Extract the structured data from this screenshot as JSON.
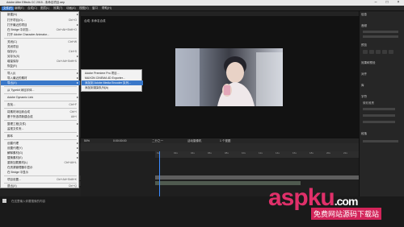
{
  "window": {
    "title": "Adobe After Effects CC 2015 - 未命名项目.aep",
    "controls": [
      "–",
      "□",
      "×"
    ]
  },
  "menubar": {
    "items": [
      "文件(F)",
      "编辑(E)",
      "合成(C)",
      "图层(L)",
      "效果(T)",
      "动画(A)",
      "视图(V)",
      "窗口",
      "帮助(H)"
    ],
    "active_index": 0
  },
  "file_menu": {
    "items": [
      {
        "label": "新建(N)",
        "shortcut": "",
        "arrow": true
      },
      {
        "label": "打开项目(O)...",
        "shortcut": "Ctrl+O"
      },
      {
        "label": "打开最近的项目",
        "shortcut": "",
        "arrow": true
      },
      {
        "label": "在 Bridge 中浏览...",
        "shortcut": "Ctrl+Alt+Shift+O"
      },
      {
        "label": "打开 Adobe Character Animator...",
        "shortcut": ""
      },
      {
        "label": "关闭(C)",
        "shortcut": "Ctrl+W"
      },
      {
        "label": "关闭项目",
        "shortcut": ""
      },
      {
        "label": "保存(S)",
        "shortcut": "Ctrl+S"
      },
      {
        "label": "另存为(S)",
        "shortcut": "",
        "arrow": true
      },
      {
        "label": "增量保存",
        "shortcut": "Ctrl+Alt+Shift+S"
      },
      {
        "label": "恢复(R)",
        "shortcut": ""
      },
      {
        "label": "导入(I)",
        "shortcut": "",
        "arrow": true
      },
      {
        "label": "导入最近的素材",
        "shortcut": "",
        "arrow": true
      },
      {
        "label": "导出(X)",
        "shortcut": "",
        "arrow": true
      },
      {
        "label": "从 Typekit 添加字体...",
        "shortcut": ""
      },
      {
        "label": "Adobe Dynamic Link",
        "shortcut": "",
        "arrow": true
      },
      {
        "label": "查找...",
        "shortcut": "Ctrl+F"
      },
      {
        "label": "将素材添加到合成",
        "shortcut": "Ctrl+/"
      },
      {
        "label": "基于所选项新建合成",
        "shortcut": "Alt+\\"
      },
      {
        "label": "整理工程(文件)",
        "shortcut": "",
        "arrow": true
      },
      {
        "label": "监视文件夹...",
        "shortcut": ""
      },
      {
        "label": "脚本",
        "shortcut": "",
        "arrow": true
      },
      {
        "label": "创建代理",
        "shortcut": "",
        "arrow": true
      },
      {
        "label": "设置代理(Y)",
        "shortcut": "",
        "arrow": true
      },
      {
        "label": "解释素材(G)",
        "shortcut": "",
        "arrow": true
      },
      {
        "label": "替换素材(E)",
        "shortcut": "",
        "arrow": true
      },
      {
        "label": "重新加载素材(L)",
        "shortcut": "Ctrl+Alt+L"
      },
      {
        "label": "在资源管理器中显示",
        "shortcut": ""
      },
      {
        "label": "在 Bridge 中显示",
        "shortcut": ""
      },
      {
        "label": "项目设置...",
        "shortcut": "Ctrl+Alt+Shift+K"
      },
      {
        "label": "退出(X)",
        "shortcut": "Ctrl+Q"
      }
    ],
    "selected_index": 13
  },
  "export_submenu": {
    "items": [
      "Adobe Premiere Pro 项目...",
      "MAXON CINEMA 4D Exporter...",
      "添加到 Adobe Media Encoder 队列...",
      "添加到渲染队列(A)"
    ],
    "selected_index": 2
  },
  "comp_tab": "合成: 未命名合成",
  "comp_controls": {
    "zoom": "50%",
    "time": "0:00:00:00",
    "resolution": "二分之一",
    "camera": "活动摄像机",
    "views": "1 个视图"
  },
  "timeline": {
    "tab": "未命名合成",
    "time": "0:00:00:00",
    "ticks": [
      "0s",
      "02s",
      "04s",
      "06s",
      "08s",
      "10s",
      "12s",
      "14s",
      "16s",
      "18s",
      "20s",
      "22s"
    ],
    "layers": [
      {
        "num": "1",
        "name": "视频素材.mp4"
      },
      {
        "num": "2",
        "name": "音乐.mp3"
      }
    ]
  },
  "right_panel": {
    "sections": [
      "信息",
      "音频",
      "预览",
      "效果和预设",
      "对齐",
      "库",
      "字符",
      "段落"
    ],
    "preview_label": "预览",
    "char_font": "微软雅黑"
  },
  "taskbar": {
    "search_placeholder": "在这里输入你要搜索的内容"
  },
  "watermark": {
    "brand": "aspku",
    "suffix": ".com",
    "tagline": "免费网站源码下载站"
  }
}
